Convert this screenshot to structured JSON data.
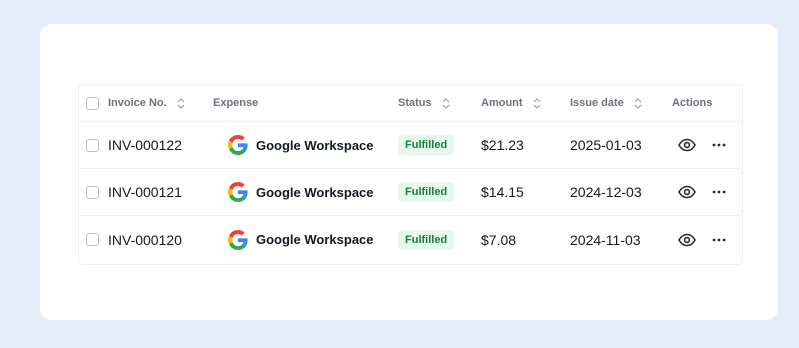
{
  "table": {
    "columns": {
      "invoice": "Invoice No.",
      "expense": "Expense",
      "status": "Status",
      "amount": "Amount",
      "issue_date": "Issue date",
      "actions": "Actions"
    },
    "rows": [
      {
        "invoice": "INV-000122",
        "expense": "Google Workspace",
        "status": "Fulfilled",
        "amount": "$21.23",
        "issue_date": "2025-01-03"
      },
      {
        "invoice": "INV-000121",
        "expense": "Google Workspace",
        "status": "Fulfilled",
        "amount": "$14.15",
        "issue_date": "2024-12-03"
      },
      {
        "invoice": "INV-000120",
        "expense": "Google Workspace",
        "status": "Fulfilled",
        "amount": "$7.08",
        "issue_date": "2024-11-03"
      }
    ]
  },
  "colors": {
    "page_bg": "#e4eefb",
    "card_bg": "#ffffff",
    "status_fulfilled_bg": "#e8f7ec",
    "status_fulfilled_text": "#15803d"
  },
  "icons": {
    "expense_logo": "google-logo-icon",
    "view_action": "eye-icon",
    "more_action": "more-horizontal-icon",
    "sort": "sort-chevrons-icon"
  }
}
